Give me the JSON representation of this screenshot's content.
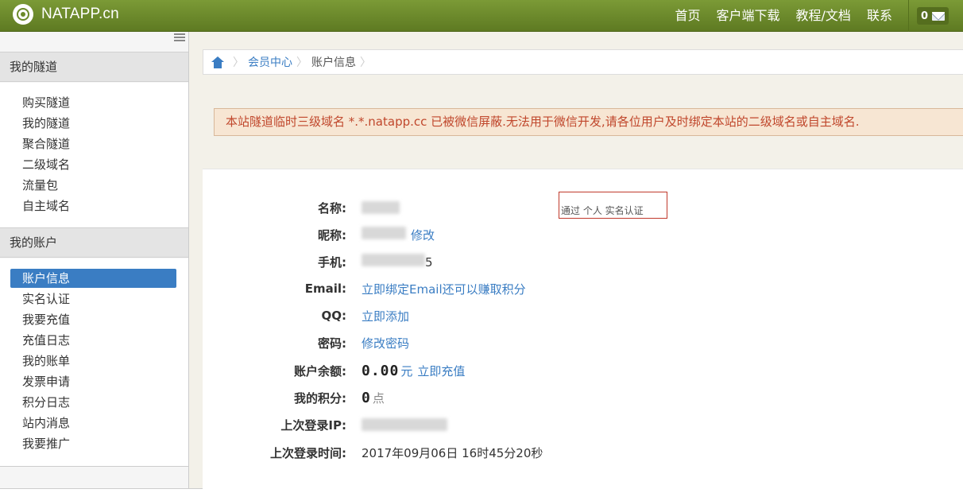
{
  "header": {
    "logo_text": "NATAPP.cn",
    "nav": [
      "首页",
      "客户端下载",
      "教程/文档",
      "联系"
    ],
    "message_count": "0"
  },
  "sidebar": {
    "section1_title": "我的隧道",
    "section1_items": [
      "购买隧道",
      "我的隧道",
      "聚合隧道",
      "二级域名",
      "流量包",
      "自主域名"
    ],
    "section2_title": "我的账户",
    "section2_items": [
      "账户信息",
      "实名认证",
      "我要充值",
      "充值日志",
      "我的账单",
      "发票申请",
      "积分日志",
      "站内消息",
      "我要推广"
    ],
    "active_item": "账户信息"
  },
  "breadcrumb": {
    "link": "会员中心",
    "current": "账户信息"
  },
  "alert": {
    "text": "本站隧道临时三级域名 *.*.natapp.cc 已被微信屏蔽.无法用于微信开发,请各位用户及时绑定本站的二级域名或自主域名."
  },
  "account": {
    "name_label": "名称:",
    "name_badge": "通过 个人 实名认证",
    "nickname_label": "昵称:",
    "nickname_action": "修改",
    "phone_label": "手机:",
    "phone_tail": "5",
    "email_label": "Email:",
    "email_action": "立即绑定Email还可以赚取积分",
    "qq_label": "QQ:",
    "qq_action": "立即添加",
    "password_label": "密码:",
    "password_action": "修改密码",
    "balance_label": "账户余额:",
    "balance_value": "0.00",
    "balance_unit": "元",
    "balance_action": "立即充值",
    "points_label": "我的积分:",
    "points_value": "0",
    "points_unit": "点",
    "last_ip_label": "上次登录IP:",
    "last_time_label": "上次登录时间:",
    "last_time_value": "2017年09月06日 16时45分20秒"
  }
}
